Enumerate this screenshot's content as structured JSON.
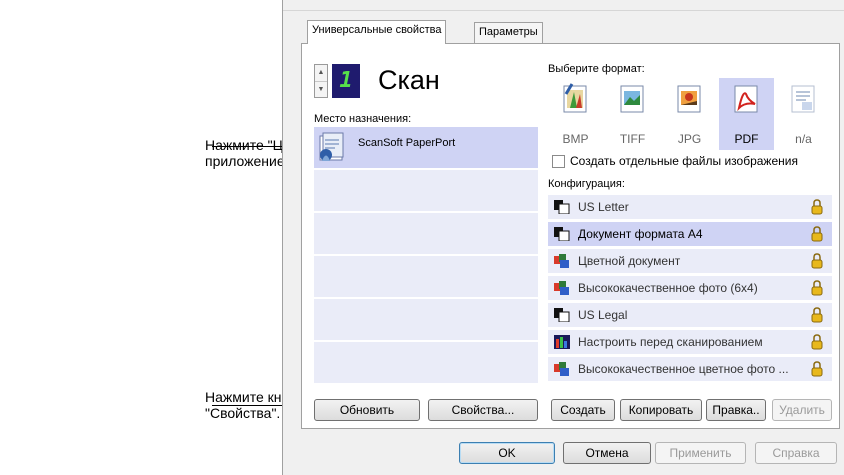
{
  "callouts": {
    "target_app": "Нажмите \"Целевое\nприложение\".",
    "properties": "Нажмите кнопку\n\"Свойства\"."
  },
  "tabs": [
    {
      "label": "Универсальные свойства",
      "active": true
    },
    {
      "label": "Параметры",
      "active": false
    }
  ],
  "scan": {
    "counter": "1",
    "title": "Скан"
  },
  "destination": {
    "label": "Место назначения:",
    "items": [
      {
        "name": "ScanSoft PaperPort",
        "icon": "paperport-icon",
        "selected": true
      },
      {
        "name": ""
      },
      {
        "name": ""
      },
      {
        "name": ""
      },
      {
        "name": ""
      },
      {
        "name": ""
      }
    ]
  },
  "format": {
    "label": "Выберите формат:",
    "items": [
      {
        "label": "BMP",
        "icon": "bmp-icon",
        "selected": false
      },
      {
        "label": "TIFF",
        "icon": "tiff-icon",
        "selected": false
      },
      {
        "label": "JPG",
        "icon": "jpg-icon",
        "selected": false
      },
      {
        "label": "PDF",
        "icon": "pdf-icon",
        "selected": true
      },
      {
        "label": "n/a",
        "icon": "text-icon",
        "selected": false
      }
    ],
    "separate_files_label": "Создать отдельные файлы изображения",
    "separate_files_checked": false
  },
  "configuration": {
    "label": "Конфигурация:",
    "items": [
      {
        "label": "US Letter",
        "icon": "bw-doc-icon",
        "selected": false
      },
      {
        "label": "Документ формата А4",
        "icon": "bw-doc-icon",
        "selected": true
      },
      {
        "label": "Цветной документ",
        "icon": "color-doc-icon",
        "selected": false
      },
      {
        "label": "Высококачественное фото (6x4)",
        "icon": "color-doc-icon",
        "selected": false
      },
      {
        "label": "US Legal",
        "icon": "bw-doc-icon",
        "selected": false
      },
      {
        "label": "Настроить перед сканированием",
        "icon": "configure-icon",
        "selected": false
      },
      {
        "label": "Высококачественное цветное фото ...",
        "icon": "color-doc-icon",
        "selected": false
      }
    ]
  },
  "buttons": {
    "refresh": "Обновить",
    "properties": "Свойства...",
    "create": "Создать",
    "copy": "Копировать",
    "edit": "Правка..",
    "delete": "Удалить",
    "ok": "OK",
    "cancel": "Отмена",
    "apply": "Применить",
    "help": "Справка"
  },
  "colors": {
    "selection": "#cfd3f4",
    "list_row": "#eaecf8",
    "counter_bg": "#1f1b6e",
    "counter_digit": "#56e04a",
    "lock": "#e8b81c"
  }
}
